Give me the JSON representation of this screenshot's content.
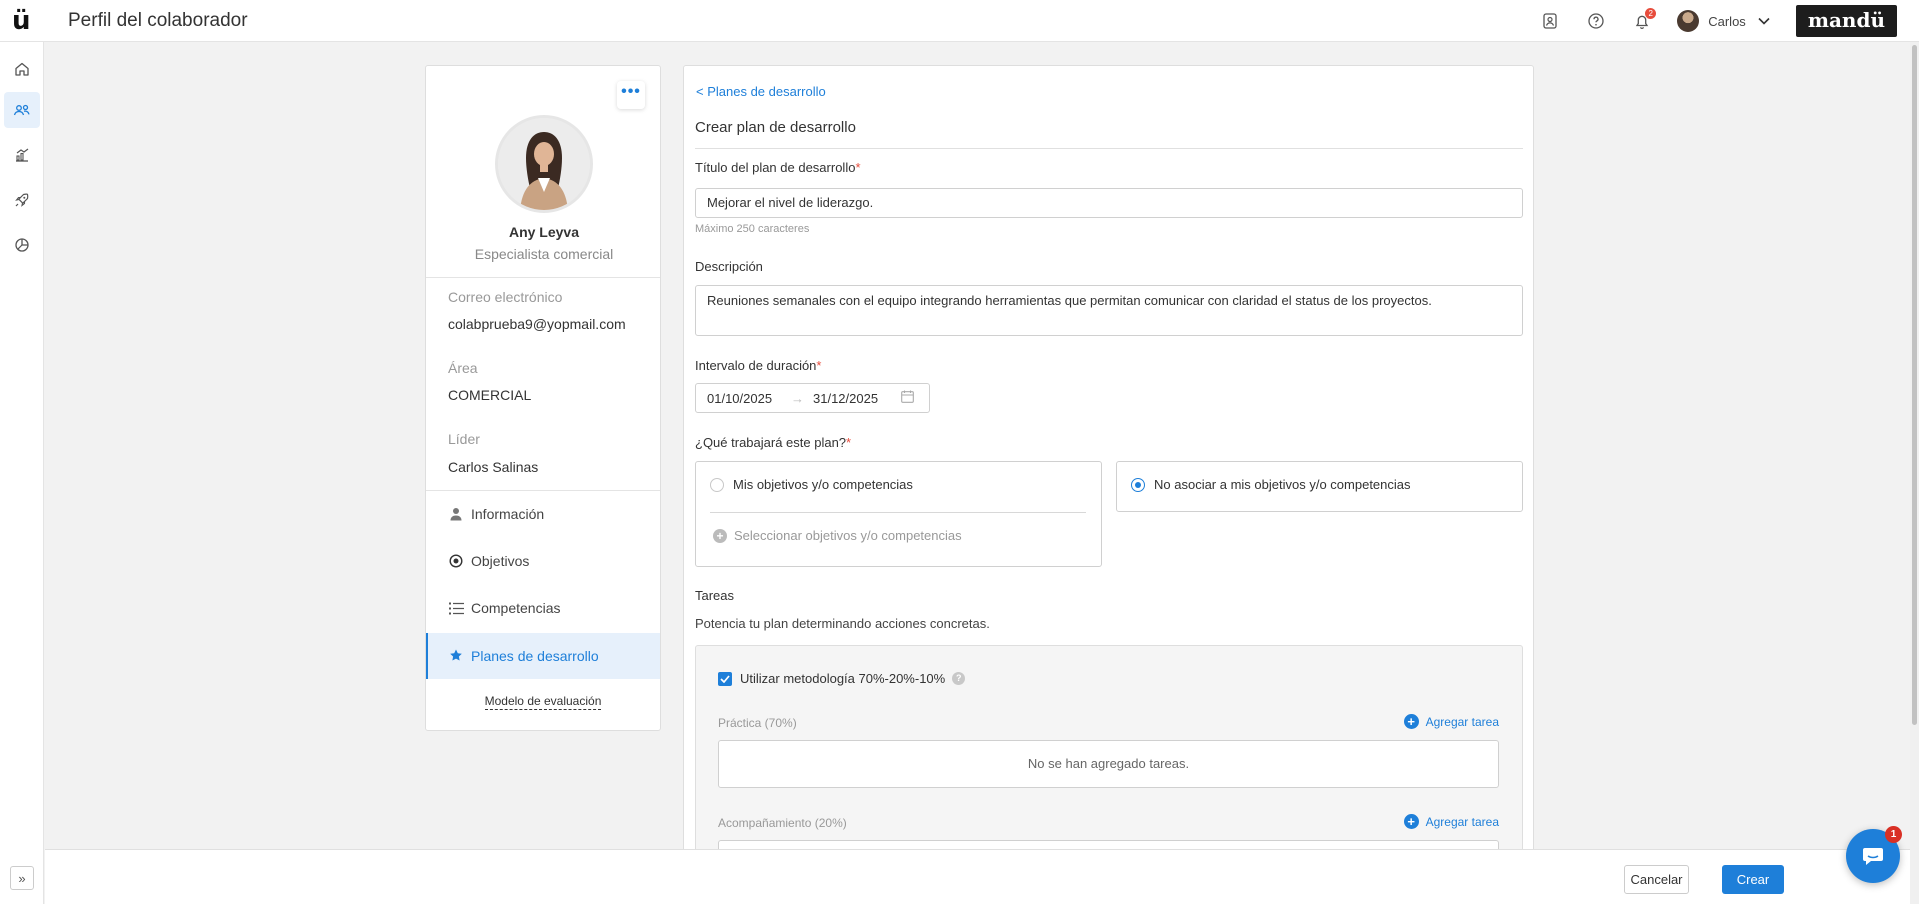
{
  "app": {
    "logo_text": "ü",
    "page_title": "Perfil del colaborador",
    "brand": "mandü",
    "notification_count": "2",
    "user_name": "Carlos"
  },
  "sidebar": {
    "items": [
      {
        "icon": "home-icon",
        "active": false
      },
      {
        "icon": "people-icon",
        "active": true
      },
      {
        "icon": "chart-icon",
        "active": false
      },
      {
        "icon": "rocket-icon",
        "active": false
      },
      {
        "icon": "pie-chart-icon",
        "active": false
      }
    ],
    "expand_label": "»"
  },
  "profile": {
    "name": "Any Leyva",
    "role": "Especialista comercial",
    "email_label": "Correo electrónico",
    "email": "colabprueba9@yopmail.com",
    "area_label": "Área",
    "area": "COMERCIAL",
    "leader_label": "Líder",
    "leader": "Carlos Salinas",
    "menu": [
      {
        "label": "Información",
        "icon": "user-icon"
      },
      {
        "label": "Objetivos",
        "icon": "target-icon"
      },
      {
        "label": "Competencias",
        "icon": "list-icon"
      },
      {
        "label": "Planes de desarrollo",
        "icon": "star-icon",
        "active": true
      }
    ],
    "eval_link": "Modelo de evaluación"
  },
  "form": {
    "back_link": "< Planes de desarrollo",
    "title": "Crear plan de desarrollo",
    "plan_title_label": "Título del plan de desarrollo",
    "plan_title_value": "Mejorar el nivel de liderazgo.",
    "plan_title_hint": "Máximo 250 caracteres",
    "description_label": "Descripción",
    "description_value": "Reuniones semanales con el equipo integrando herramientas que permitan comunicar con claridad el status de los proyectos.",
    "duration_label": "Intervalo de duración",
    "date_start": "01/10/2025",
    "date_end": "31/12/2025",
    "work_label": "¿Qué trabajará este plan?",
    "option_objectives": "Mis objetivos y/o competencias",
    "select_objectives": "Seleccionar objetivos y/o competencias",
    "option_no_associate": "No asociar a mis objetivos y/o competencias",
    "selected_option": "no_associate",
    "tasks_label": "Tareas",
    "tasks_subtitle": "Potencia tu plan determinando acciones concretas.",
    "methodology_label": "Utilizar metodología 70%-20%-10%",
    "methodology_checked": true,
    "practice_label": "Práctica (70%)",
    "add_task": "Agregar tarea",
    "no_tasks": "No se han agregado tareas.",
    "accompaniment_label": "Acompañamiento (20%)"
  },
  "footer": {
    "cancel": "Cancelar",
    "create": "Crear"
  },
  "chat": {
    "badge": "1"
  },
  "colors": {
    "accent": "#1e7fd9",
    "required": "#e74c3c"
  }
}
